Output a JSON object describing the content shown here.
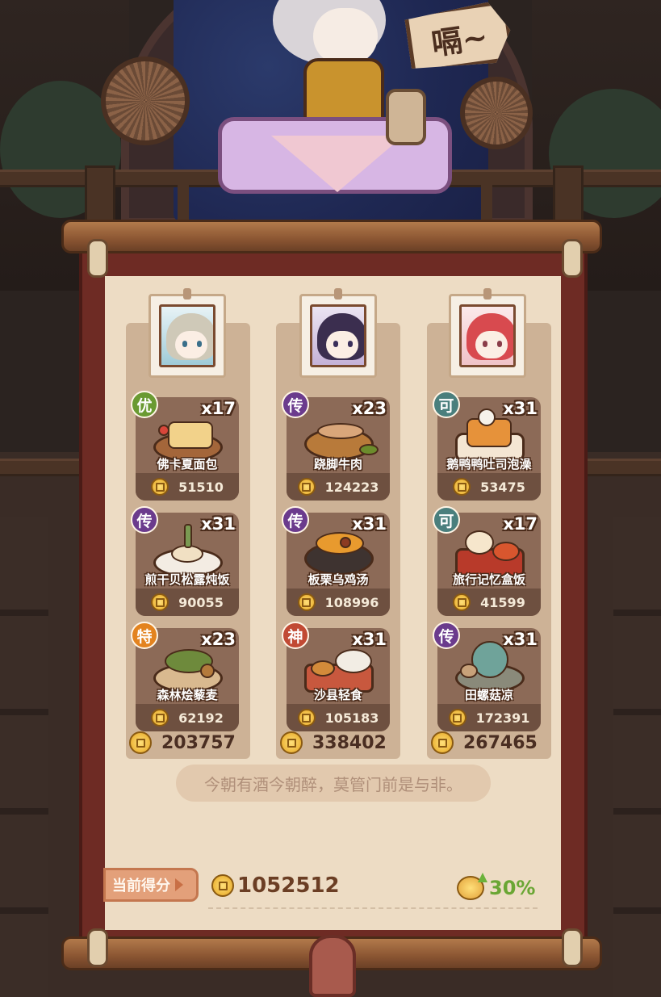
{
  "header": {
    "sign_text": "嗝~"
  },
  "columns": [
    {
      "character": "character-1",
      "dishes": [
        {
          "rarity": "优",
          "rarity_color": "#6a9a32",
          "qty": "x17",
          "name": "佛卡夏面包",
          "score": "51510"
        },
        {
          "rarity": "传",
          "rarity_color": "#6b3b8d",
          "qty": "x31",
          "name": "煎干贝松露炖饭",
          "score": "90055"
        },
        {
          "rarity": "特",
          "rarity_color": "#e3831f",
          "qty": "x23",
          "name": "森林烩藜麦",
          "score": "62192"
        }
      ],
      "total": "203757"
    },
    {
      "character": "character-2",
      "dishes": [
        {
          "rarity": "传",
          "rarity_color": "#6b3b8d",
          "qty": "x23",
          "name": "跷脚牛肉",
          "score": "124223"
        },
        {
          "rarity": "传",
          "rarity_color": "#6b3b8d",
          "qty": "x31",
          "name": "板栗乌鸡汤",
          "score": "108996"
        },
        {
          "rarity": "神",
          "rarity_color": "#c14a34",
          "qty": "x31",
          "name": "沙县轻食",
          "score": "105183"
        }
      ],
      "total": "338402"
    },
    {
      "character": "character-3",
      "dishes": [
        {
          "rarity": "可",
          "rarity_color": "#4a7f7d",
          "qty": "x31",
          "name": "鹅鸭鸭吐司泡澡",
          "score": "53475"
        },
        {
          "rarity": "可",
          "rarity_color": "#4a7f7d",
          "qty": "x17",
          "name": "旅行记忆盒饭",
          "score": "41599"
        },
        {
          "rarity": "传",
          "rarity_color": "#6b3b8d",
          "qty": "x31",
          "name": "田螺菇凉",
          "score": "172391"
        }
      ],
      "total": "267465"
    }
  ],
  "quote": "今朝有酒今朝醉，莫管门前是与非。",
  "score": {
    "label": "当前得分",
    "total": "1052512",
    "bonus": "30%"
  },
  "colors": {
    "scroll_frame": "#6e2b24",
    "paper": "#eddcc4",
    "card": "#8c6a57",
    "bonus_green": "#6aa634"
  }
}
